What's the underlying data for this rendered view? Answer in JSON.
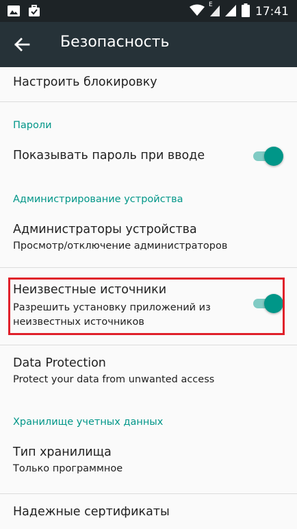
{
  "status_bar": {
    "time": "17:41",
    "network_label": "E",
    "left_icons": [
      "image-icon",
      "briefcase-check-icon"
    ],
    "right_icons": [
      "wifi-icon",
      "signal-e-icon",
      "signal-icon",
      "battery-icon"
    ]
  },
  "app_bar": {
    "title": "Безопасность",
    "back_icon": "arrow-back-icon"
  },
  "items": {
    "configure_lock": {
      "title": "Настроить блокировку"
    },
    "passwords_header": "Пароли",
    "show_password": {
      "title": "Показывать пароль при вводе",
      "enabled": true
    },
    "device_admin_header": "Администрирование устройства",
    "device_admins": {
      "title": "Администраторы устройства",
      "summary": "Просмотр/отключение администраторов"
    },
    "unknown_sources": {
      "title": "Неизвестные источники",
      "summary_line1": "Разрешить установку приложений из",
      "summary_line2": "неизвестных источников",
      "enabled": true
    },
    "data_protection": {
      "title": "Data Protection",
      "summary": "Protect your data from unwanted access"
    },
    "credential_storage_header": "Хранилище учетных данных",
    "storage_type": {
      "title": "Тип хранилища",
      "summary": "Только программное"
    },
    "trusted_certs": {
      "title": "Надежные сертификаты"
    }
  },
  "colors": {
    "accent": "#009688",
    "app_bar": "#263238",
    "status_bar": "#1d2326",
    "highlight": "#e0202a"
  }
}
